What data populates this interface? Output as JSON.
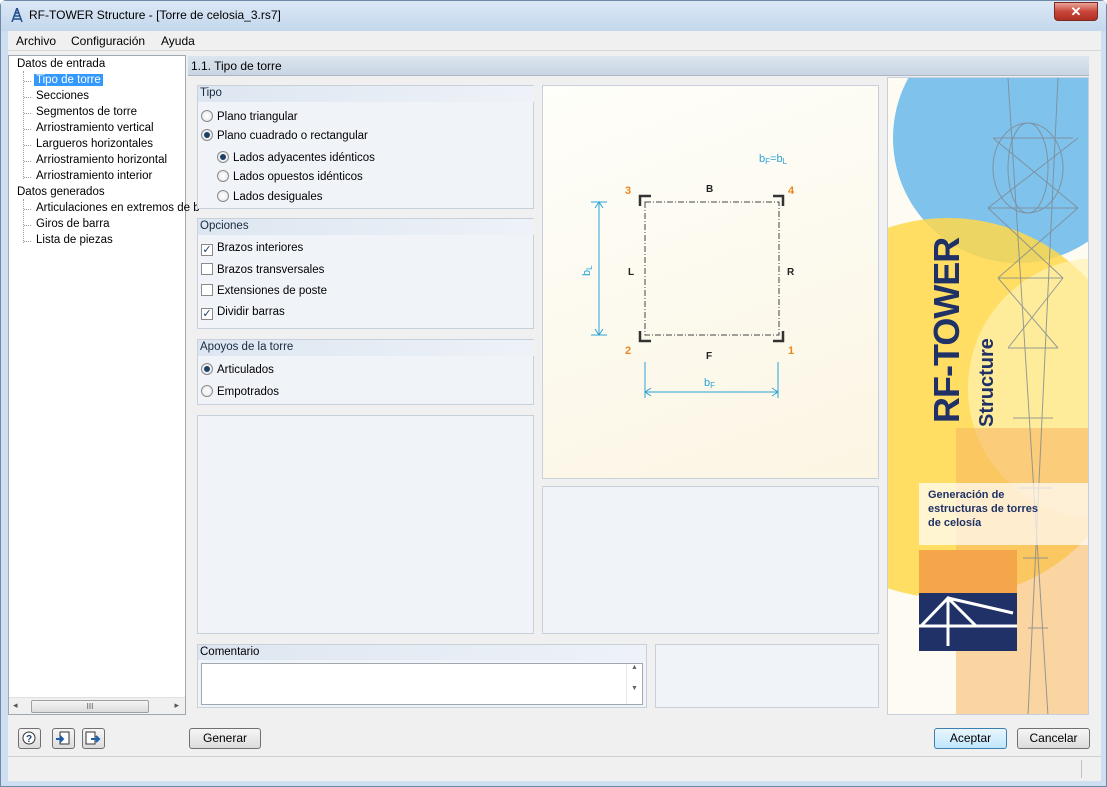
{
  "window": {
    "title": "RF-TOWER Structure - [Torre de celosia_3.rs7]",
    "close_label": "✕"
  },
  "menu": [
    "Archivo",
    "Configuración",
    "Ayuda"
  ],
  "tree": {
    "root1": "Datos de entrada",
    "items1": [
      "Tipo de torre",
      "Secciones",
      "Segmentos de torre",
      "Arriostramiento vertical",
      "Largueros horizontales",
      "Arriostramiento horizontal",
      "Arriostramiento interior"
    ],
    "root2": "Datos generados",
    "items2": [
      "Articulaciones en extremos de b",
      "Giros de barra",
      "Lista de piezas"
    ],
    "scroll_grip": "III"
  },
  "section_title": "1.1. Tipo de torre",
  "tipo": {
    "title": "Tipo",
    "plano_triangular": "Plano triangular",
    "plano_cuadrado": "Plano cuadrado o rectangular",
    "adyacentes": "Lados adyacentes idénticos",
    "opuestos": "Lados opuestos idénticos",
    "desiguales": "Lados desiguales",
    "selected": "Plano cuadrado o rectangular",
    "sub_selected": "Lados adyacentes idénticos"
  },
  "opciones": {
    "title": "Opciones",
    "brazos_interiores": "Brazos interiores",
    "brazos_transversales": "Brazos transversales",
    "extensiones": "Extensiones de poste",
    "dividir": "Dividir barras",
    "checked": [
      "Brazos interiores",
      "Dividir barras"
    ]
  },
  "apoyos": {
    "title": "Apoyos de la torre",
    "articulados": "Articulados",
    "empotrados": "Empotrados",
    "selected": "Articulados"
  },
  "diagram": {
    "eq": "bF=bL",
    "eq_b1": "b",
    "eq_s1": "F",
    "eq_mid": "=b",
    "eq_s2": "L",
    "n3": "3",
    "n4": "4",
    "n2": "2",
    "n1": "1",
    "B": "B",
    "L": "L",
    "R": "R",
    "F": "F",
    "bL": "b",
    "bL_sub": "L",
    "bF": "b",
    "bF_sub": "F",
    "colors": {
      "accent": "#e8881e",
      "dim": "#2aa3d8",
      "frame": "#333333"
    }
  },
  "brand": {
    "title": "RF-TOWER",
    "subtitle": "Structure",
    "desc1": "Generación de",
    "desc2": "estructuras de torres",
    "desc3": "de celosía"
  },
  "comment": {
    "title": "Comentario"
  },
  "buttons": {
    "generar": "Generar",
    "aceptar": "Aceptar",
    "cancelar": "Cancelar"
  },
  "icons": [
    "help-icon",
    "import-icon",
    "export-icon"
  ]
}
